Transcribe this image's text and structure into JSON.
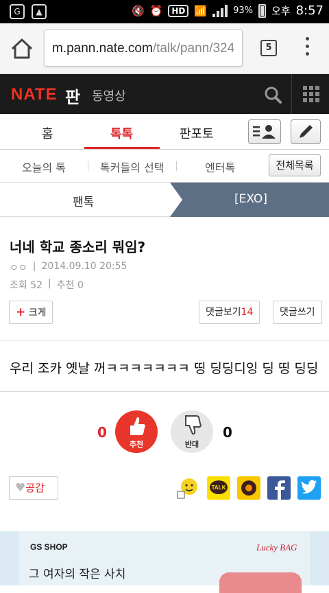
{
  "status_bar": {
    "battery": "93%",
    "ampm": "오후",
    "time": "8:57",
    "hd_label": "HD"
  },
  "browser": {
    "url_host": "m.pann.nate.com",
    "url_path": "/talk/pann/324",
    "tab_count": "5"
  },
  "nate_header": {
    "logo": "NATE",
    "logo_suffix": "판",
    "video_label": "동영상"
  },
  "main_nav": {
    "tabs": [
      {
        "label": "홈"
      },
      {
        "label": "톡톡"
      },
      {
        "label": "판포토"
      }
    ],
    "active_tab": "톡톡"
  },
  "sub_nav": {
    "items": [
      {
        "label": "오늘의 톡"
      },
      {
        "label": "톡커들의 선택"
      },
      {
        "label": "엔터톡"
      }
    ],
    "all_button": "전체목록"
  },
  "breadcrumb": {
    "level1": "팬톡",
    "level2": "[EXO]"
  },
  "article": {
    "title": "너네 학교 종소리 뭐임?",
    "author": "ㅇㅇ",
    "date": "2014.09.10 20:55",
    "views_label": "조회",
    "views": "52",
    "recommend_label": "추천",
    "recommend": "0",
    "bigger_label": "크게",
    "comments_view_label": "댓글보기",
    "comments_count": "14",
    "write_comment_label": "댓글쓰기",
    "body": "우리 조카 옛날 꺼ㅋㅋㅋㅋㅋㅋㅋ 띵 딩딩디잉 딩 띵 딩딩"
  },
  "vote": {
    "up_count": "0",
    "up_label": "추천",
    "down_label": "반대",
    "down_count": "0"
  },
  "share": {
    "empathy_label": "공감",
    "kakao_label": "TALK",
    "icons": [
      "emoticon-icon",
      "kakaotalk-icon",
      "kakaostory-icon",
      "facebook-icon",
      "twitter-icon"
    ]
  },
  "ad": {
    "brand_left": "GS SHOP",
    "brand_right": "Lucky BAG",
    "copy": "그 여자의 작은 사치"
  },
  "colors": {
    "accent_red": "#e0262c",
    "nate_bar": "#1b1b1b",
    "breadcrumb_blue": "#5c6f84",
    "facebook": "#3b5998",
    "twitter": "#1da1f2",
    "kakao": "#f9e000"
  }
}
